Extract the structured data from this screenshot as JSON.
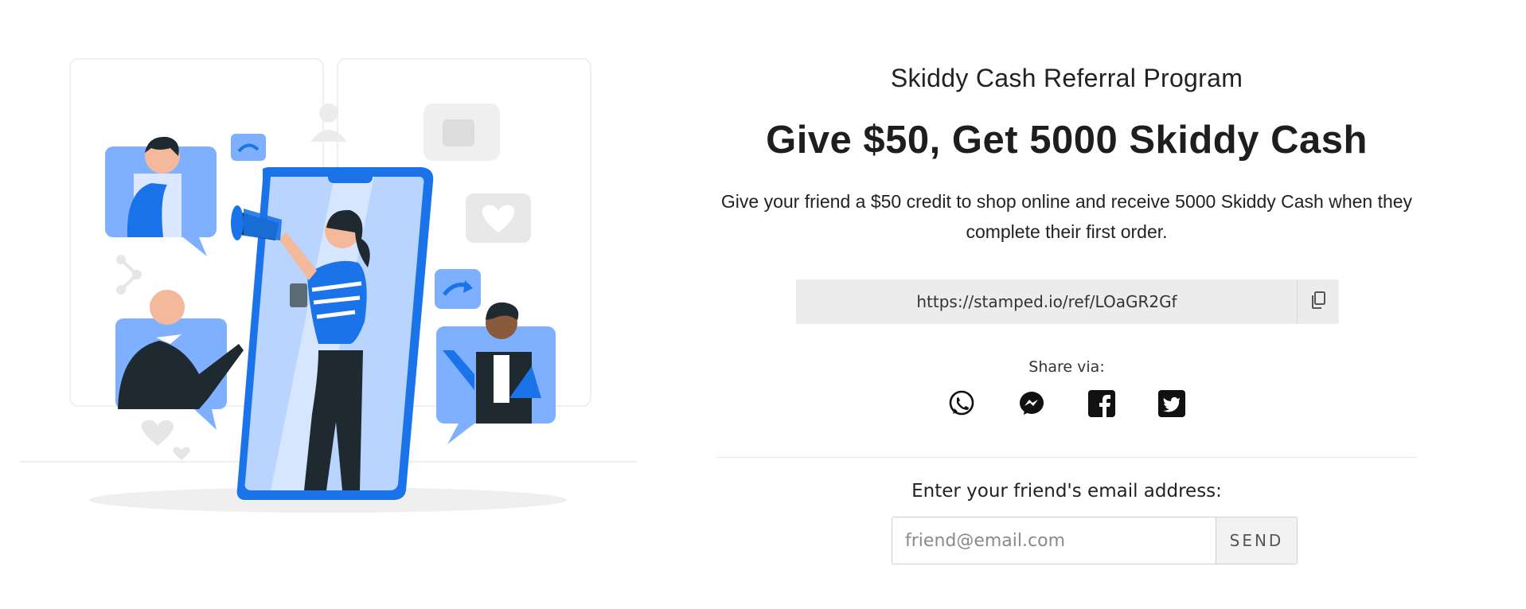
{
  "referral": {
    "program_title": "Skiddy Cash Referral Program",
    "headline": "Give $50, Get 5000 Skiddy Cash",
    "description": "Give your friend a $50 credit to shop online and receive 5000 Skiddy Cash when they complete their first order.",
    "referral_link": "https://stamped.io/ref/LOaGR2Gf",
    "copy_icon": "copy-icon"
  },
  "share": {
    "label": "Share via:",
    "icons": [
      "whatsapp-icon",
      "messenger-icon",
      "facebook-icon",
      "twitter-icon"
    ]
  },
  "email": {
    "label": "Enter your friend's email address:",
    "placeholder": "friend@email.com",
    "value": "",
    "send_label": "SEND"
  },
  "colors": {
    "accent_blue": "#1a73e8",
    "light_blue": "#7fb0ff",
    "dark": "#1f2a30",
    "link_box": "#ececec"
  }
}
